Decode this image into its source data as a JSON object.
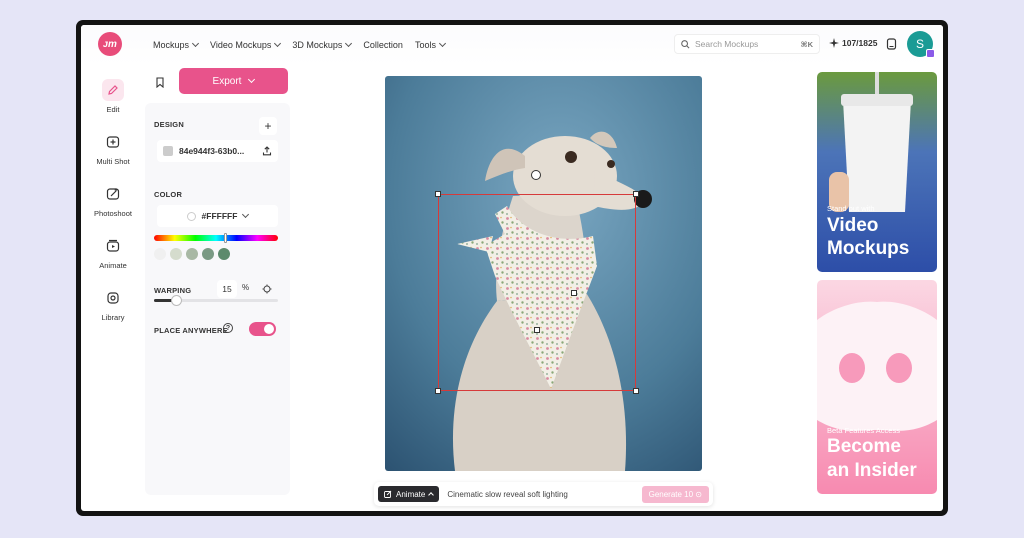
{
  "topbar": {
    "logo_text": "ᴊm",
    "nav": [
      {
        "label": "Mockups",
        "dropdown": true
      },
      {
        "label": "Video Mockups",
        "dropdown": true
      },
      {
        "label": "3D Mockups",
        "dropdown": true
      },
      {
        "label": "Collection",
        "dropdown": false
      },
      {
        "label": "Tools",
        "dropdown": true
      }
    ],
    "search": {
      "placeholder": "Search Mockups",
      "shortcut": "⌘K"
    },
    "credits": "107/1825",
    "avatar_initial": "S"
  },
  "rail": {
    "items": [
      {
        "label": "Edit",
        "icon": "pencil-icon",
        "active": true
      },
      {
        "label": "Multi Shot",
        "icon": "multi-shot-icon",
        "active": false
      },
      {
        "label": "Photoshoot",
        "icon": "photoshoot-icon",
        "active": false
      },
      {
        "label": "Animate",
        "icon": "animate-icon",
        "active": false
      },
      {
        "label": "Library",
        "icon": "library-icon",
        "active": false
      }
    ]
  },
  "panel": {
    "export_label": "Export",
    "design": {
      "title": "DESIGN",
      "file_name": "84e944f3-63b0..."
    },
    "color": {
      "title": "COLOR",
      "value": "#FFFFFF",
      "swatches": [
        "#f0f0f0",
        "#d5dccd",
        "#a8b8a4",
        "#7a9a84",
        "#5c8a6c"
      ]
    },
    "warping": {
      "title": "WARPING",
      "value": "15",
      "unit": "%",
      "level": 0.18
    },
    "place_anywhere": {
      "title": "PLACE ANYWHERE",
      "help": "?",
      "enabled": true
    }
  },
  "animate_bar": {
    "button_label": "Animate",
    "prompt_value": "Cinematic slow reveal soft lighting",
    "generate_label": "Generate 10 ⊙"
  },
  "ads": {
    "video": {
      "small": "Stand out with",
      "line1": "Video",
      "line2": "Mockups"
    },
    "insider": {
      "small": "Beta Features Access",
      "line1": "Become",
      "line2": "an Insider"
    }
  },
  "colors": {
    "accent": "#e8538b",
    "frame": "#131313",
    "background": "#e5e5f7",
    "selection": "#d63a3a"
  }
}
